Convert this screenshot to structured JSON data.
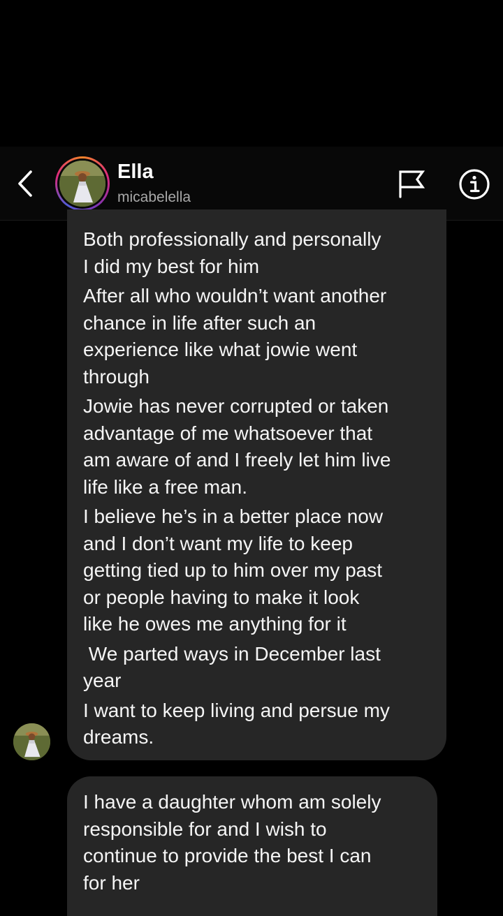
{
  "header": {
    "name": "Ella",
    "username": "micabelella"
  },
  "messages": [
    {
      "paragraphs": [
        [
          "Both professionally and personally",
          "I did my best for him"
        ],
        [
          "After all who wouldn’t want another",
          "chance in life after such an",
          "experience like what jowie went",
          "through"
        ],
        [
          "Jowie has never corrupted or taken",
          "advantage of me whatsoever that",
          "am aware of and I freely let him live",
          "life like a free man."
        ],
        [
          "I believe he’s in a better place now",
          "and I don’t want my life to keep",
          "getting tied up to him over my past",
          "or people having to make it look",
          "like he owes me anything for it"
        ],
        [
          " We parted ways in December last",
          "year"
        ],
        [
          "I want to keep living and persue my",
          "dreams."
        ]
      ]
    },
    {
      "paragraphs": [
        [
          "I have a daughter whom am solely",
          "responsible for and I wish to",
          "continue to provide the best I can",
          "for her"
        ]
      ]
    }
  ],
  "icons": {
    "back": "chevron-left-icon",
    "flag": "flag-icon",
    "info": "info-icon"
  },
  "colors": {
    "background": "#000000",
    "bubble": "#262626",
    "text": "#f5f5f5",
    "secondary_text": "#a8a8a8"
  }
}
